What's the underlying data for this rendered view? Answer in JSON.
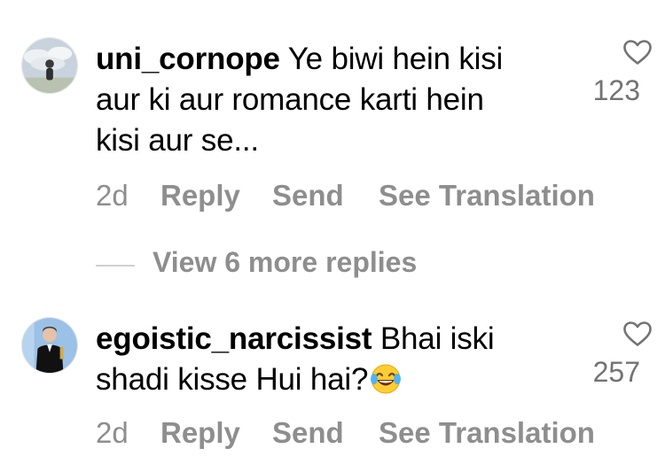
{
  "comments": [
    {
      "username": "uni_cornope",
      "text_lines": [
        "Ye biwi hein kisi",
        "aur ki aur romance karti hein",
        "kisi aur se..."
      ],
      "likes": "123",
      "time": "2d",
      "reply_label": "Reply",
      "send_label": "Send",
      "translate_label": "See Translation"
    },
    {
      "username": "egoistic_narcissist",
      "text_lines": [
        "Bhai iski",
        "shadi kisse Hui hai?"
      ],
      "emoji": "face-with-tears-of-joy",
      "likes": "257",
      "time": "2d",
      "reply_label": "Reply",
      "send_label": "Send",
      "translate_label": "See Translation"
    }
  ],
  "view_more": {
    "label": "View 6 more replies"
  },
  "icons": {
    "like": "heart-outline-icon"
  },
  "colors": {
    "text": "#000000",
    "secondary": "#8e8e8e",
    "like_count": "#737373",
    "divider": "#d0d0d0"
  }
}
